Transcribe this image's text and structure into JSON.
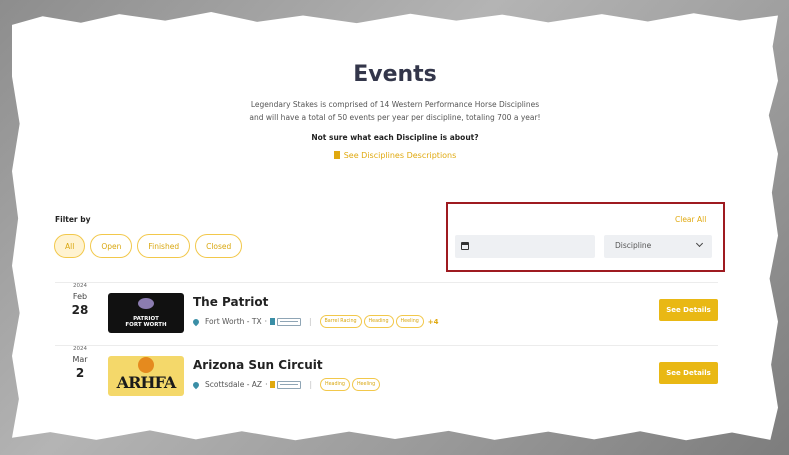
{
  "header": {
    "title": "Events",
    "description_line1": "Legendary Stakes is comprised of 14 Western Performance Horse Disciplines",
    "description_line2": "and will have a total of 50 events per year per discipline, totaling 700 a year!",
    "question": "Not sure what each Discipline is about?",
    "disciplines_link": "See Disciplines Descriptions"
  },
  "filters": {
    "label": "Filter by",
    "chips": [
      "All",
      "Open",
      "Finished",
      "Closed"
    ],
    "active_chip": "All",
    "clear_all": "Clear All",
    "date_value": "",
    "discipline_selected": "Discipline"
  },
  "events": [
    {
      "year": "2024",
      "month": "Feb",
      "day": "28",
      "thumb_text_line1": "PATRIOT",
      "thumb_text_line2": "FORT WORTH",
      "name": "The Patriot",
      "location": "Fort Worth - TX",
      "tags": [
        "Barrel Racing",
        "Heading",
        "Heeling"
      ],
      "more": "+4",
      "button": "See Details"
    },
    {
      "year": "2024",
      "month": "Mar",
      "day": "2",
      "thumb_text_line1": "ARHFA",
      "name": "Arizona Sun Circuit",
      "location": "Scottsdale - AZ",
      "tags": [
        "Heading",
        "Heeling"
      ],
      "button": "See Details"
    }
  ],
  "colors": {
    "accent": "#e9b814",
    "highlight_box": "#9e1a20",
    "title": "#33364a"
  }
}
